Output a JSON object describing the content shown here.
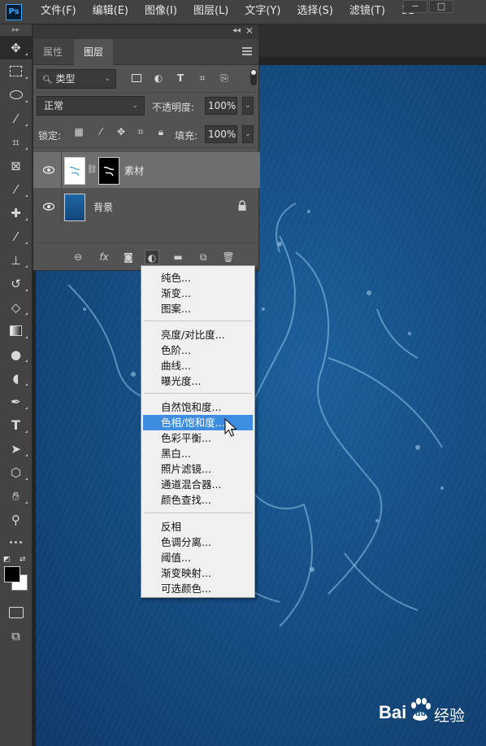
{
  "menubar": {
    "logo": "Ps",
    "items": [
      "文件(F)",
      "编辑(E)",
      "图像(I)",
      "图层(L)",
      "文字(Y)",
      "选择(S)",
      "滤镜(T)",
      "3D"
    ],
    "minimize": "−",
    "maximize": "□"
  },
  "panel": {
    "collapse_glyph": "◂◂",
    "close_glyph": "✕",
    "tabs": [
      "属性",
      "图层"
    ],
    "active_tab": "图层",
    "filter": {
      "value": "类型",
      "search_glyph": "🔍︎",
      "arrow": "⌄"
    },
    "blend_mode": "正常",
    "opacity_label": "不透明度:",
    "opacity_value": "100%",
    "lock_label": "锁定:",
    "fill_label": "填充:",
    "fill_value": "100%",
    "layers": [
      {
        "name": "素材",
        "selected": true,
        "has_mask": true
      },
      {
        "name": "背景",
        "selected": false,
        "locked": true
      }
    ],
    "footer_glyphs": {
      "link": "⊖",
      "fx": "fx",
      "mask": "◙",
      "adjustment": "◐",
      "group": "▬",
      "new": "⧉",
      "delete": "🗑︎"
    }
  },
  "adjustment_menu": {
    "groups": [
      [
        "纯色...",
        "渐变...",
        "图案..."
      ],
      [
        "亮度/对比度...",
        "色阶...",
        "曲线...",
        "曝光度..."
      ],
      [
        "自然饱和度...",
        "色相/饱和度...",
        "色彩平衡...",
        "黑白...",
        "照片滤镜...",
        "通道混合器...",
        "颜色查找..."
      ],
      [
        "反相",
        "色调分离...",
        "阈值...",
        "渐变映射...",
        "可选颜色..."
      ]
    ],
    "highlighted": "色相/饱和度..."
  },
  "toolbar": {
    "grip": "▸▸",
    "tools": [
      "move-icon",
      "marquee-icon",
      "lasso-icon",
      "quick-select-icon",
      "crop-icon",
      "frame-icon",
      "eyedropper-icon",
      "healing-icon",
      "brush-icon",
      "stamp-icon",
      "history-brush-icon",
      "eraser-icon",
      "gradient-icon",
      "blur-icon",
      "dodge-icon",
      "pen-icon",
      "type-icon",
      "path-select-icon",
      "shape-icon",
      "hand-icon",
      "zoom-icon",
      "more-icon"
    ],
    "type_tool_glyph": "T",
    "more_glyph": "•••"
  },
  "watermark": {
    "brand_left": "Bai",
    "brand_right": "经验",
    "paw": "du"
  },
  "colors": {
    "accent": "#3d8de0",
    "canvas_blue": "#164f86",
    "panel_bg": "#535353",
    "toolbar_bg": "#434343"
  }
}
